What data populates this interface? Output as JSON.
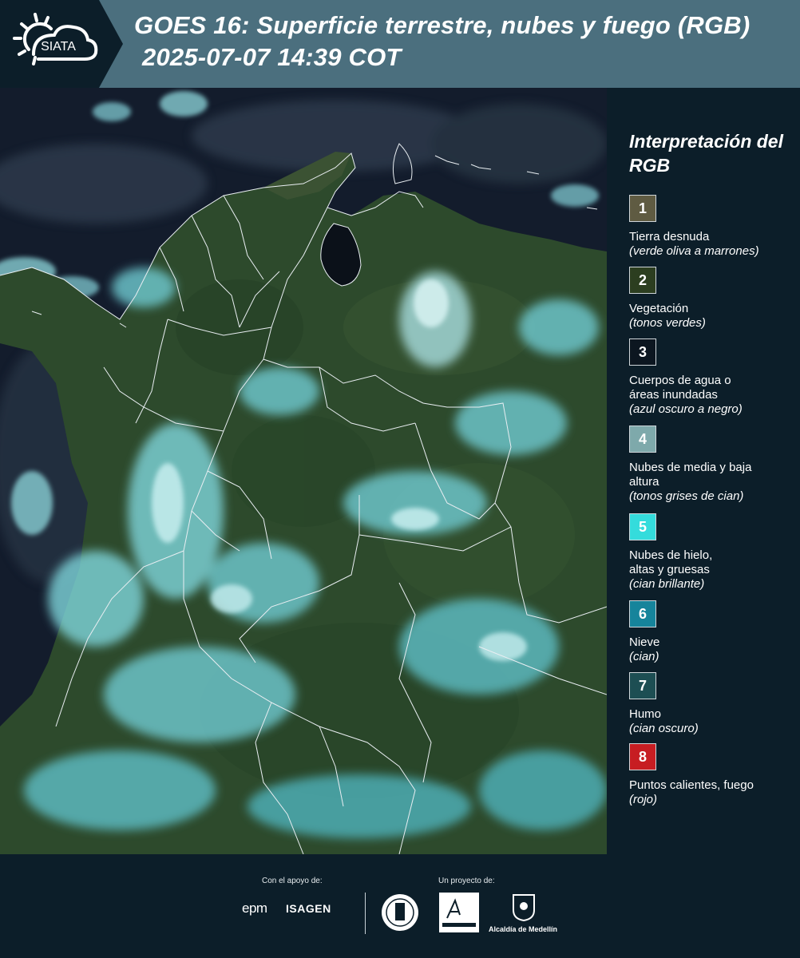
{
  "header": {
    "logo_text": "SIATA",
    "title_line1": "GOES 16: Superficie terrestre, nubes y fuego (RGB)",
    "title_line2": "2025-07-07 14:39 COT",
    "band_color": "#4b6f7e"
  },
  "legend": {
    "title": "Interpretación del RGB",
    "items": [
      {
        "number": "1",
        "color": "#5f5b42",
        "label": "Tierra desnuda",
        "sub": "(verde oliva a marrones)"
      },
      {
        "number": "2",
        "color": "#2c3e20",
        "label": "Vegetación",
        "sub": "(tonos verdes)"
      },
      {
        "number": "3",
        "color": "#0c1620",
        "label": "Cuerpos de agua o áreas inundadas",
        "sub": "(azul oscuro a negro)"
      },
      {
        "number": "4",
        "color": "#7ea9ab",
        "label": "Nubes de media y baja altura",
        "sub": "(tonos grises de cian)"
      },
      {
        "number": "5",
        "color": "#34dcdc",
        "label": "Nubes de hielo, altas y gruesas",
        "sub": "(cian brillante)"
      },
      {
        "number": "6",
        "color": "#16849b",
        "label": "Nieve",
        "sub": "(cian)"
      },
      {
        "number": "7",
        "color": "#1d4e53",
        "label": "Humo",
        "sub": "(cian oscuro)"
      },
      {
        "number": "8",
        "color": "#c71d22",
        "label": "Puntos calientes, fuego",
        "sub": "(rojo)"
      }
    ]
  },
  "footer": {
    "support_label": "Con el apoyo de:",
    "project_label": "Un proyecto de:",
    "epm": "epm",
    "isagen": "ISAGEN",
    "medellin": "Alcaldía de Medellín"
  },
  "map": {
    "ocean_color": "#131c2c",
    "land_color": "#2d4a2c",
    "cloud_color": "#7fd6dc",
    "border_color": "#e9eef2"
  }
}
